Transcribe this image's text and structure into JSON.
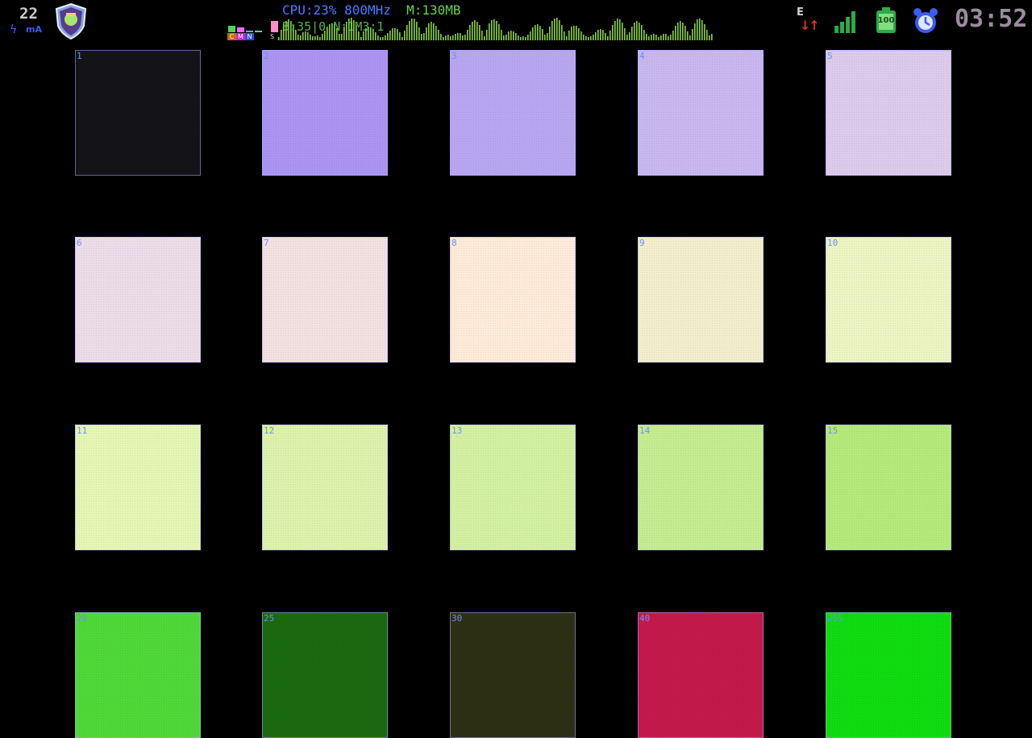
{
  "status": {
    "battery_level": "22",
    "battery_unit": "mA",
    "cpu_label": "CPU:23% 800MHz",
    "mem_label": "M:130MB",
    "overlay_line": "B:35|0 N:1M3:1",
    "cmns_labels": [
      "C",
      "M",
      "N",
      "S"
    ],
    "net_type": "E",
    "net_arrows": "↓↑",
    "battery2_value": "100",
    "clock": "03:52",
    "colors": {
      "cpu_text": "#4a7cff",
      "mem_text": "#6ad04a",
      "clock_text": "#9a8c9c",
      "signal": "#2fa84a"
    }
  },
  "grid": {
    "tiles": [
      {
        "label": "1",
        "color": "#141418"
      },
      {
        "label": "2",
        "color": "#ab94f2"
      },
      {
        "label": "3",
        "color": "#b9a6f2"
      },
      {
        "label": "4",
        "color": "#c9b7ee"
      },
      {
        "label": "5",
        "color": "#dccbea"
      },
      {
        "label": "6",
        "color": "#ecdde8"
      },
      {
        "label": "7",
        "color": "#f2e1e0"
      },
      {
        "label": "8",
        "color": "#ffebd8"
      },
      {
        "label": "9",
        "color": "#f3efcd"
      },
      {
        "label": "10",
        "color": "#ecf5c3"
      },
      {
        "label": "11",
        "color": "#e5f6b5"
      },
      {
        "label": "12",
        "color": "#ddf2aa"
      },
      {
        "label": "13",
        "color": "#d3f0a2"
      },
      {
        "label": "14",
        "color": "#c5ec8f"
      },
      {
        "label": "15",
        "color": "#b5ea7a"
      },
      {
        "label": "20",
        "color": "#4fd838"
      },
      {
        "label": "25",
        "color": "#1a6a10"
      },
      {
        "label": "30",
        "color": "#2c2f14"
      },
      {
        "label": "40",
        "color": "#c21a4a"
      },
      {
        "label": "255",
        "color": "#10dc10"
      }
    ]
  }
}
